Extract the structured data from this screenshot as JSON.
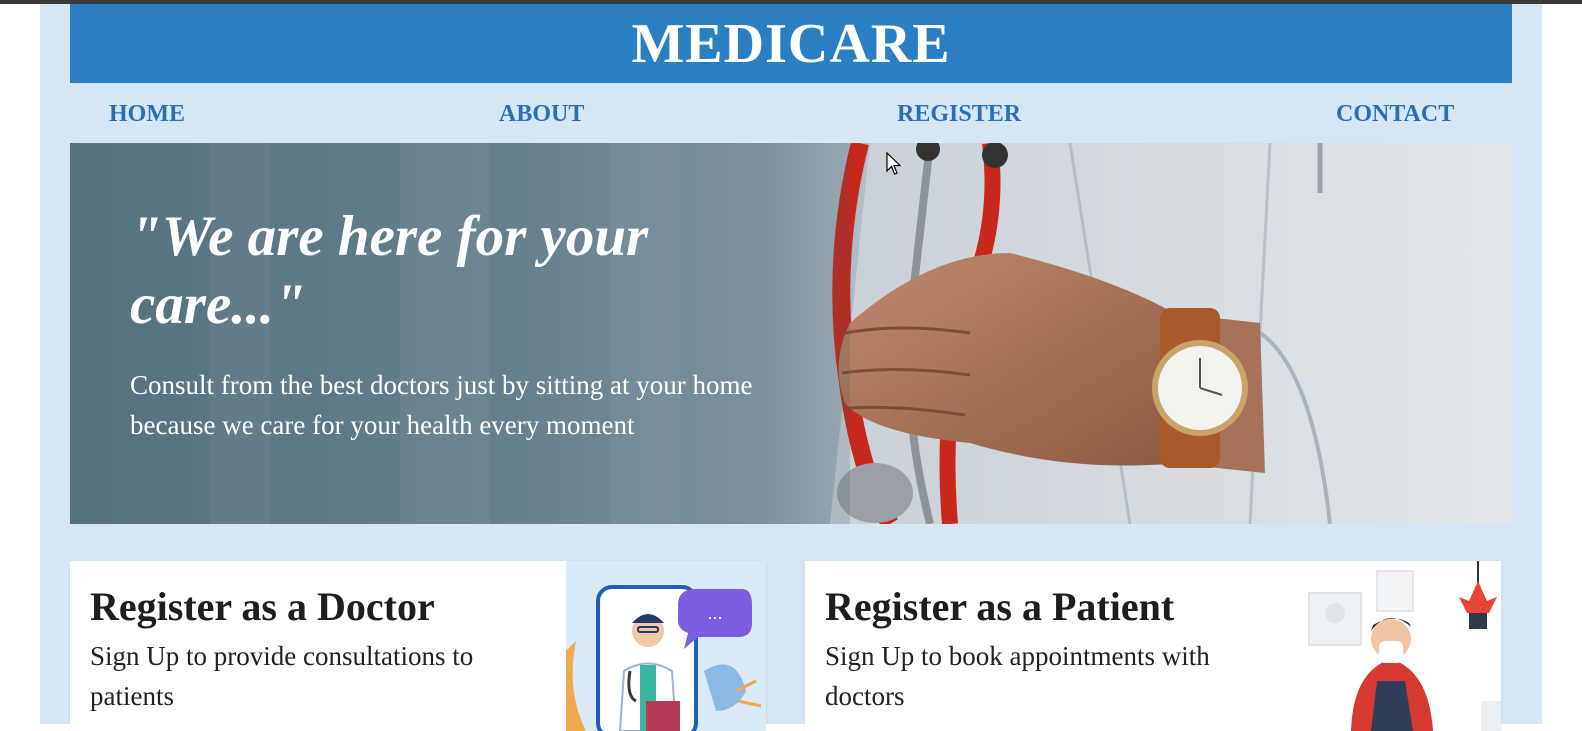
{
  "app": {
    "brand": "MEDICARE"
  },
  "nav": {
    "items": [
      {
        "label": "HOME"
      },
      {
        "label": "ABOUT"
      },
      {
        "label": "REGISTER"
      },
      {
        "label": "CONTACT"
      }
    ]
  },
  "hero": {
    "title": "\"We are here for your care...\"",
    "subtitle": "Consult from the best doctors just by sitting at your home because we care for your health every moment"
  },
  "cards": [
    {
      "title": "Register as a Doctor",
      "text": "Sign Up to provide consultations to patients",
      "illustration_bubble": "..."
    },
    {
      "title": "Register as a Patient",
      "text": "Sign Up to book appointments with doctors"
    }
  ],
  "colors": {
    "brand_blue": "#2a7fc3",
    "nav_text": "#2a6fb5",
    "page_bg": "#d6e6f4"
  },
  "icons": {
    "cursor": "mouse-pointer-icon"
  }
}
